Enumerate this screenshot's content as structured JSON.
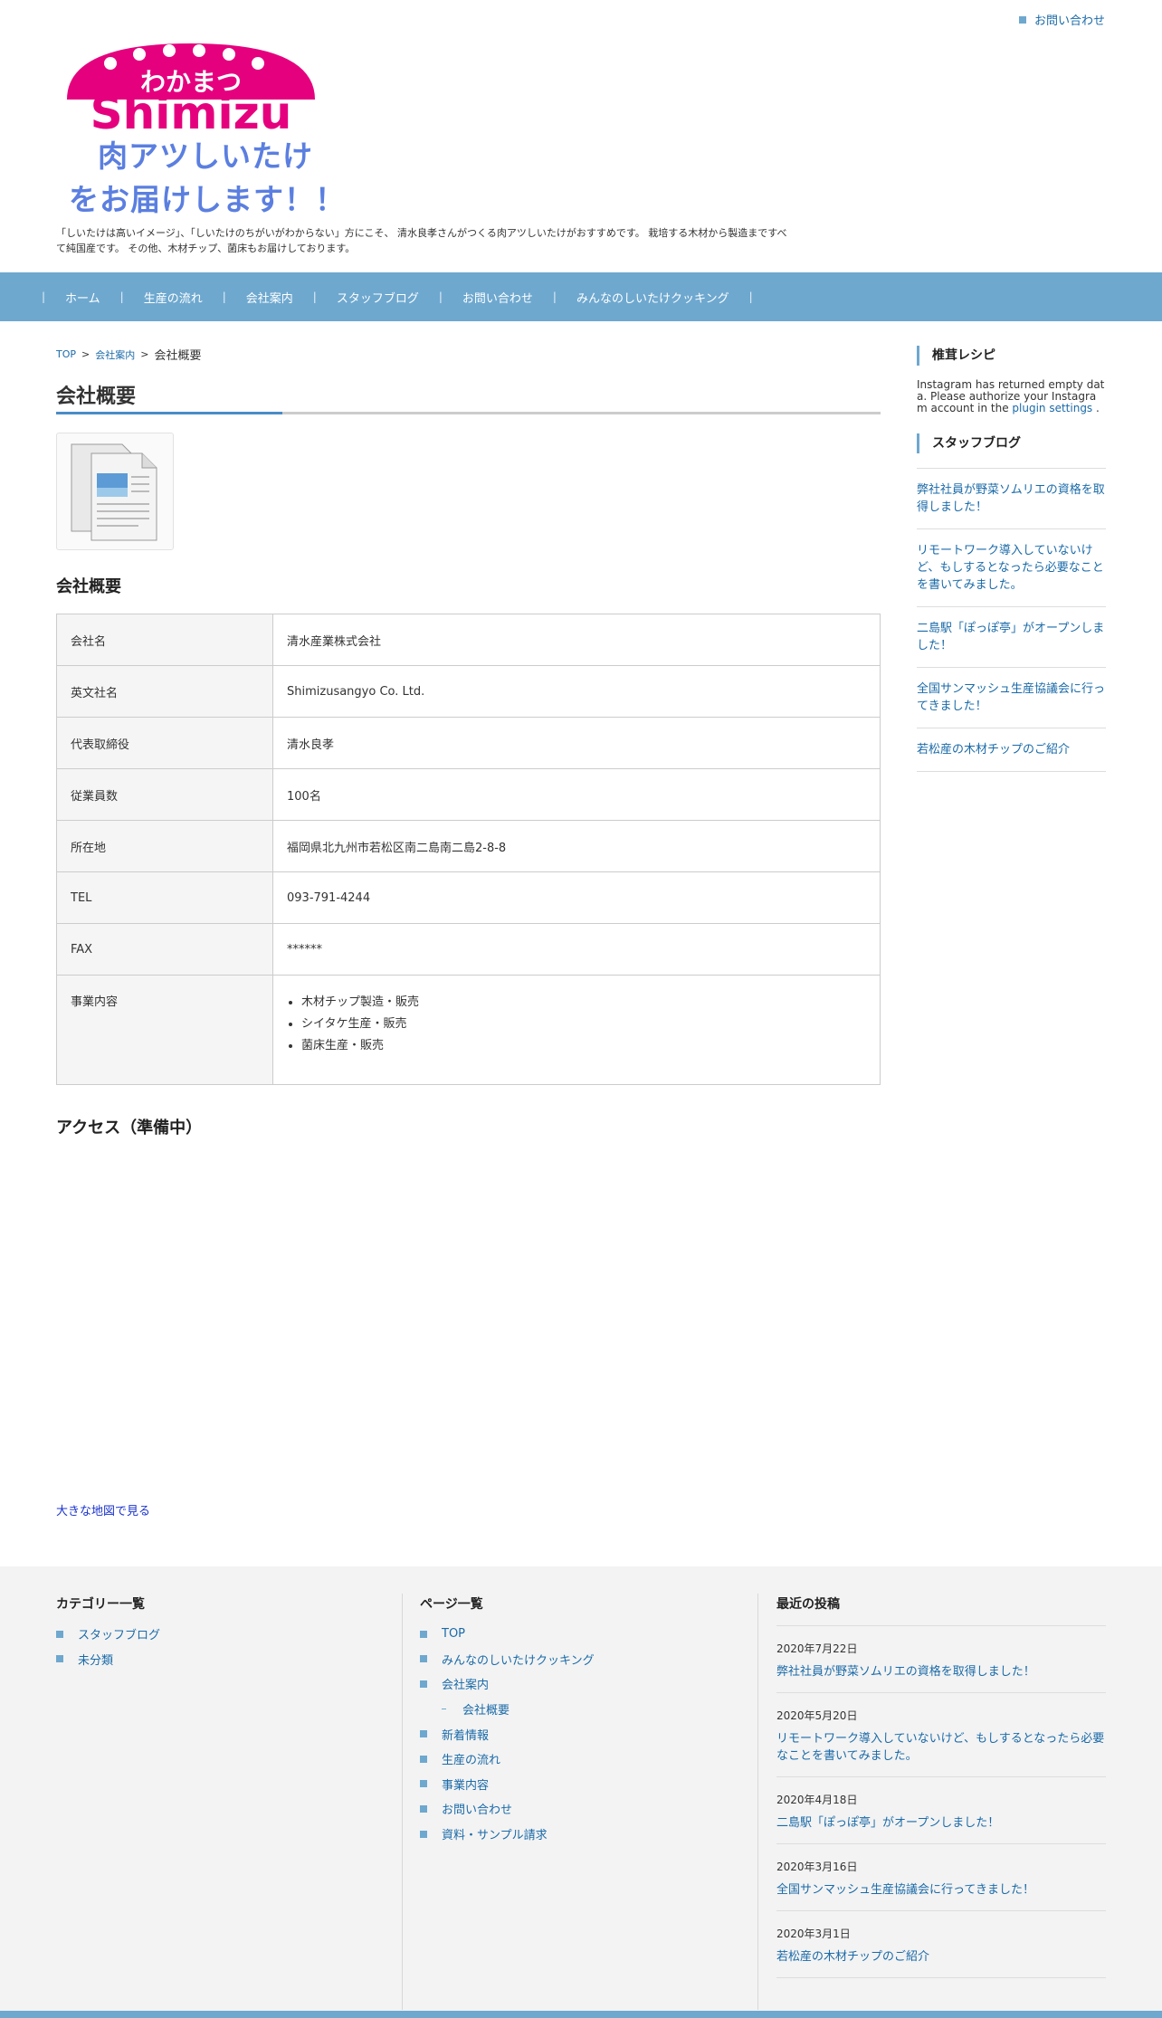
{
  "header": {
    "top_contact": "お問い合わせ",
    "logo_text_top": "わかまつ",
    "logo_text_main": "Shimizu",
    "tagline_line1": "肉アツしいたけ",
    "tagline_line2": "をお届けします！！",
    "description": "「しいたけは高いイメージ」、「しいたけのちがいがわからない」方にこそ、 清水良孝さんがつくる肉アツしいたけがおすすめです。 栽培する木材から製造まですべて純国産です。 その他、木材チップ、菌床もお届けしております。"
  },
  "colors": {
    "accent": "#6ea8cf",
    "logo_pink": "#e5007e",
    "logo_brown": "#b47a2a",
    "tagline_blue": "#5b7fe0"
  },
  "nav": {
    "separator": "|",
    "items": [
      "ホーム",
      "生産の流れ",
      "会社案内",
      "スタッフブログ",
      "お問い合わせ",
      "みんなのしいたけクッキング"
    ]
  },
  "breadcrumb": {
    "top": "TOP",
    "sep": ">",
    "parent": "会社案内",
    "current": "会社概要"
  },
  "main": {
    "page_title": "会社概要",
    "section_title": "会社概要",
    "table": {
      "rows": [
        {
          "key": "会社名",
          "value": "清水産業株式会社"
        },
        {
          "key": "英文社名",
          "value": "Shimizusangyo Co. Ltd."
        },
        {
          "key": "代表取締役",
          "value": "清水良孝"
        },
        {
          "key": "従業員数",
          "value": "100名"
        },
        {
          "key": "所在地",
          "value": "福岡県北九州市若松区南二島南二島2-8-8"
        },
        {
          "key": "TEL",
          "value": "093-791-4244"
        },
        {
          "key": "FAX",
          "value": "******"
        }
      ],
      "business_key": "事業内容",
      "business_items": [
        "木材チップ製造・販売",
        "シイタケ生産・販売",
        "菌床生産・販売"
      ]
    },
    "access_title": "アクセス（準備中）",
    "big_map_link": "大きな地図で見る"
  },
  "sidebar": {
    "recipe_title": "椎茸レシピ",
    "instagram_text": "Instagram has returned empty data. Please authorize your Instagram account in the",
    "instagram_link": "plugin settings",
    "instagram_end": ".",
    "blog_title": "スタッフブログ",
    "blog_items": [
      "弊社社員が野菜ソムリエの資格を取得しました！",
      "リモートワーク導入していないけど、もしするとなったら必要なことを書いてみました。",
      "二島駅「ぽっぽ亭」がオープンしました！",
      "全国サンマッシュ生産協議会に行ってきました！",
      "若松産の木材チップのご紹介"
    ]
  },
  "footer": {
    "categories_title": "カテゴリー一覧",
    "categories": [
      "スタッフブログ",
      "未分類"
    ],
    "pages_title": "ページ一覧",
    "pages": [
      "TOP",
      "みんなのしいたけクッキング",
      "会社案内",
      "会社概要",
      "新着情報",
      "生産の流れ",
      "事業内容",
      "お問い合わせ",
      "資料・サンプル請求"
    ],
    "recent_title": "最近の投稿",
    "recent": [
      {
        "date": "2020年7月22日",
        "title": "弊社社員が野菜ソムリエの資格を取得しました！"
      },
      {
        "date": "2020年5月20日",
        "title": "リモートワーク導入していないけど、もしするとなったら必要なことを書いてみました。"
      },
      {
        "date": "2020年4月18日",
        "title": "二島駅「ぽっぽ亭」がオープンしました！"
      },
      {
        "date": "2020年3月16日",
        "title": "全国サンマッシュ生産協議会に行ってきました！"
      },
      {
        "date": "2020年3月1日",
        "title": "若松産の木材チップのご紹介"
      }
    ]
  }
}
